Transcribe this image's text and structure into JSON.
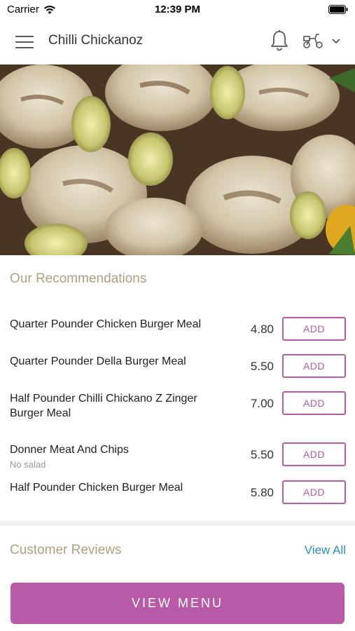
{
  "status_bar": {
    "carrier": "Carrier",
    "time": "12:39 PM"
  },
  "header": {
    "title": "Chilli Chickanoz"
  },
  "hero": {
    "image": "grilled-chicken-skewers-photo"
  },
  "recommendations": {
    "title": "Our Recommendations",
    "add_label": "ADD",
    "items": [
      {
        "name": "Quarter Pounder Chicken Burger Meal",
        "sub": "",
        "price": "4.80"
      },
      {
        "name": "Quarter Pounder Della Burger Meal",
        "sub": "",
        "price": "5.50"
      },
      {
        "name": "Half Pounder Chilli Chickano Z Zinger Burger Meal",
        "sub": "",
        "price": "7.00"
      },
      {
        "name": "Donner Meat And Chips",
        "sub": "No salad",
        "price": "5.50"
      },
      {
        "name": "Half Pounder Chicken Burger Meal",
        "sub": "",
        "price": "5.80"
      }
    ]
  },
  "reviews": {
    "title": "Customer Reviews",
    "view_all": "View All"
  },
  "footer": {
    "view_menu": "VIEW MENU"
  },
  "colors": {
    "accent": "#b85aa8",
    "section_title": "#b0a080",
    "link": "#2a8fbf"
  }
}
